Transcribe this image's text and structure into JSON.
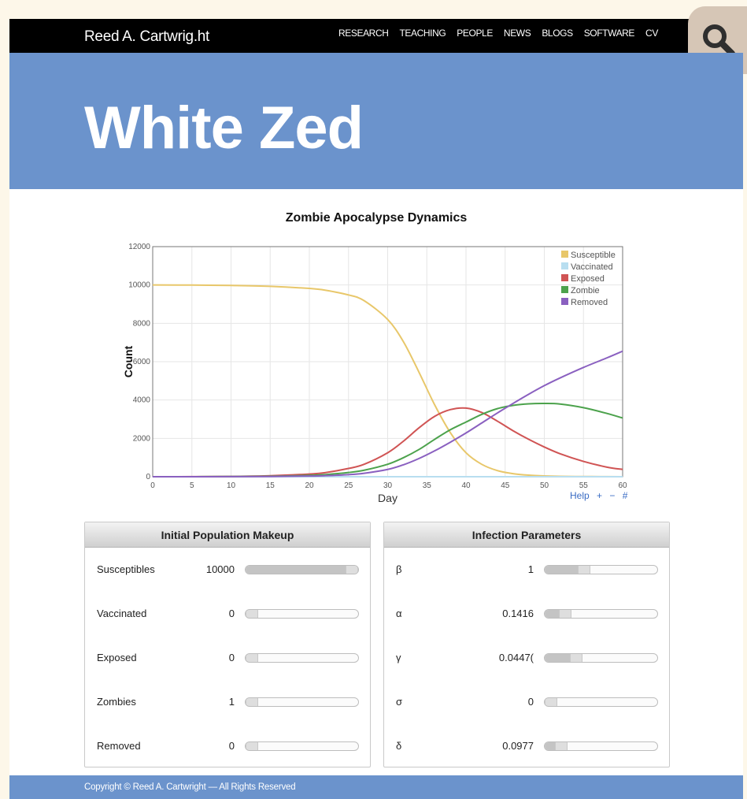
{
  "header": {
    "brand": "Reed A. Cartwrig.ht",
    "nav": [
      "RESEARCH",
      "TEACHING",
      "PEOPLE",
      "NEWS",
      "BLOGS",
      "SOFTWARE",
      "CV"
    ],
    "search_icon": "magnifier-icon"
  },
  "hero": {
    "title": "White Zed"
  },
  "chart_data": {
    "type": "line",
    "title": "Zombie Apocalypse Dynamics",
    "xlabel": "Day",
    "ylabel": "Count",
    "xlim": [
      0,
      60
    ],
    "ylim": [
      0,
      12000
    ],
    "xticks": [
      0,
      5,
      10,
      15,
      20,
      25,
      30,
      35,
      40,
      45,
      50,
      55,
      60
    ],
    "yticks": [
      0,
      2000,
      4000,
      6000,
      8000,
      10000,
      12000
    ],
    "grid": true,
    "legend_position": "top-right",
    "x": [
      0,
      5,
      10,
      15,
      20,
      22,
      25,
      27,
      30,
      32,
      34,
      36,
      38,
      40,
      42,
      44,
      46,
      48,
      50,
      52,
      55,
      58,
      60
    ],
    "series": [
      {
        "name": "Susceptible",
        "color": "#e8c76a",
        "values": [
          10000,
          9995,
          9975,
          9930,
          9820,
          9730,
          9480,
          9180,
          8200,
          7050,
          5450,
          3750,
          2300,
          1250,
          650,
          320,
          160,
          80,
          40,
          20,
          10,
          5,
          2
        ]
      },
      {
        "name": "Vaccinated",
        "color": "#b8def0",
        "values": [
          0,
          0,
          0,
          0,
          0,
          0,
          0,
          0,
          0,
          0,
          0,
          0,
          0,
          0,
          0,
          0,
          0,
          0,
          0,
          0,
          0,
          0,
          0
        ]
      },
      {
        "name": "Exposed",
        "color": "#d05454",
        "values": [
          0,
          3,
          15,
          50,
          140,
          210,
          430,
          650,
          1250,
          1850,
          2550,
          3150,
          3500,
          3580,
          3350,
          2900,
          2400,
          1950,
          1550,
          1200,
          800,
          500,
          380
        ]
      },
      {
        "name": "Zombie",
        "color": "#4ca24c",
        "values": [
          1,
          2,
          8,
          25,
          70,
          110,
          220,
          340,
          650,
          990,
          1420,
          1950,
          2450,
          2850,
          3250,
          3550,
          3720,
          3800,
          3820,
          3790,
          3600,
          3300,
          3060
        ]
      },
      {
        "name": "Removed",
        "color": "#8a60c0",
        "values": [
          0,
          1,
          3,
          12,
          35,
          55,
          110,
          180,
          380,
          620,
          950,
          1350,
          1800,
          2280,
          2800,
          3320,
          3820,
          4300,
          4750,
          5150,
          5700,
          6200,
          6550
        ]
      }
    ]
  },
  "chart_links": [
    "Help",
    "+",
    "−",
    "#"
  ],
  "population_panel": {
    "title": "Initial Population Makeup",
    "rows": [
      {
        "label": "Susceptibles",
        "value": "10000",
        "level": 1.0
      },
      {
        "label": "Vaccinated",
        "value": "0",
        "level": 0.0
      },
      {
        "label": "Exposed",
        "value": "0",
        "level": 0.0
      },
      {
        "label": "Zombies",
        "value": "1",
        "level": 0.0
      },
      {
        "label": "Removed",
        "value": "0",
        "level": 0.0
      }
    ]
  },
  "infection_panel": {
    "title": "Infection Parameters",
    "rows": [
      {
        "label": "β",
        "value": "1",
        "level": 0.33
      },
      {
        "label": "α",
        "value": "0.1416",
        "level": 0.14
      },
      {
        "label": "γ",
        "value": "0.0447(",
        "level": 0.25
      },
      {
        "label": "σ",
        "value": "0",
        "level": 0.0
      },
      {
        "label": "δ",
        "value": "0.0977",
        "level": 0.1
      }
    ]
  },
  "footer": {
    "text": "Copyright © Reed A. Cartwright — All Rights Reserved"
  }
}
